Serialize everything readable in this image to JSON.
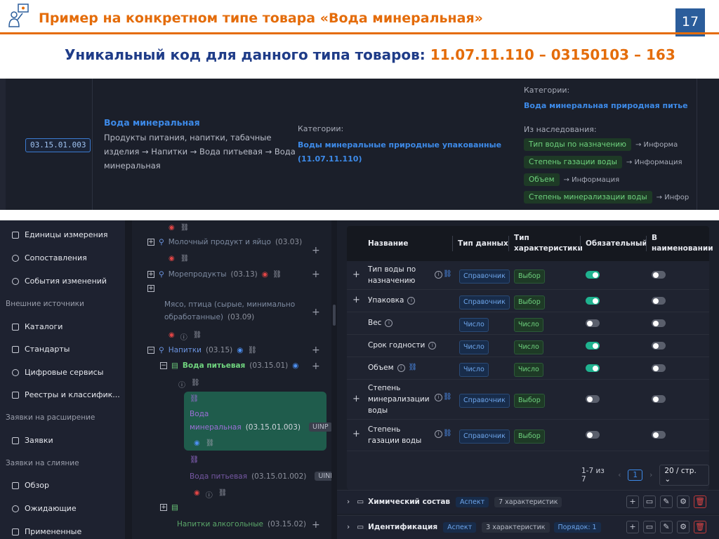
{
  "slide": {
    "title": "Пример на конкретном типе товара «Вода минеральная»",
    "number": "17",
    "subtitle_label": "Уникальный код для данного типа товаров: ",
    "subtitle_code": "11.07.11.110 – 03150103 –  163"
  },
  "top_panel": {
    "code": "03.15.01.003",
    "product_name": "Вода минеральная",
    "breadcrumb_lines": [
      "Продукты питания, напитки, табачные",
      "изделия → Напитки → Вода питьевая → Вода",
      "минеральная"
    ],
    "categories_label": "Категории:",
    "categories_value_lines": [
      "Воды минеральные природные упакованные",
      "(11.07.11.110)"
    ],
    "right_categories_label": "Категории:",
    "right_categories_value": "Вода минеральная природная питье",
    "inheritance_label": "Из наследования:",
    "inherited": [
      {
        "tag": "Тип воды по назначению",
        "info": "→ Информа"
      },
      {
        "tag": "Степень газации воды",
        "info": "→ Информация"
      },
      {
        "tag": "Объем",
        "info": "→ Информация"
      },
      {
        "tag": "Степень минерализации воды",
        "info": "→ Инфор"
      }
    ]
  },
  "sidebar": {
    "items": [
      {
        "type": "item",
        "label": "Единицы измерения"
      },
      {
        "type": "item",
        "label": "Сопоставления"
      },
      {
        "type": "item",
        "label": "События изменений"
      },
      {
        "type": "group",
        "label": "Внешние источники"
      },
      {
        "type": "item",
        "label": "Каталоги"
      },
      {
        "type": "item",
        "label": "Стандарты"
      },
      {
        "type": "item",
        "label": "Цифровые сервисы"
      },
      {
        "type": "item",
        "label": "Реестры и классифик..."
      },
      {
        "type": "group",
        "label": "Заявки на расширение"
      },
      {
        "type": "item",
        "label": "Заявки"
      },
      {
        "type": "group",
        "label": "Заявки на слияние"
      },
      {
        "type": "item",
        "label": "Обзор"
      },
      {
        "type": "item",
        "label": "Ожидающие"
      },
      {
        "type": "item",
        "label": "Примененные"
      }
    ]
  },
  "tree": {
    "dairy": {
      "name": "Молочный продукт и яйцо",
      "code": "(03.03)"
    },
    "seafood": {
      "name": "Морепродукты",
      "code": "(03.13)"
    },
    "meat_lines": [
      "Мясо, птица (сырые, минимально",
      "обработанные)"
    ],
    "meat_code": "(03.09)",
    "drinks": {
      "name": "Напитки",
      "code": "(03.15)"
    },
    "water": {
      "name": "Вода питьевая",
      "code": "(03.15.01)"
    },
    "mineral_line1": "Вода",
    "mineral_line2": "минеральная",
    "mineral_code": "(03.15.01.003)",
    "mineral_badge": "UINP",
    "drinking_water": {
      "name": "Вода питьевая",
      "code": "(03.15.01.002)",
      "badge": "UINP"
    },
    "alcohol": {
      "name": "Напитки алкогольные",
      "code": "(03.15.02)"
    }
  },
  "table": {
    "headers": {
      "name": "Название",
      "data_type": "Тип данных",
      "char_type_1": "Тип",
      "char_type_2": "характеристики",
      "required": "Обязательный",
      "in_name_1": "В",
      "in_name_2": "наименовании"
    },
    "rows": [
      {
        "name_lines": [
          "Тип воды по",
          "назначению"
        ],
        "has_link": true,
        "data_type": "Справочник",
        "char_type": "Выбор",
        "required": true,
        "in_name": false
      },
      {
        "name_lines": [
          "Упаковка"
        ],
        "has_link": false,
        "data_type": "Справочник",
        "char_type": "Выбор",
        "required": true,
        "in_name": false
      },
      {
        "name_lines": [
          "Вес"
        ],
        "has_link": false,
        "data_type": "Число",
        "char_type": "Число",
        "required": false,
        "in_name": false
      },
      {
        "name_lines": [
          "Срок годности"
        ],
        "has_link": false,
        "data_type": "Число",
        "char_type": "Число",
        "required": true,
        "in_name": false
      },
      {
        "name_lines": [
          "Объем"
        ],
        "has_link": true,
        "data_type": "Число",
        "char_type": "Число",
        "required": true,
        "in_name": false
      },
      {
        "name_lines": [
          "Степень",
          "минерализации",
          "воды"
        ],
        "has_link": true,
        "data_type": "Справочник",
        "char_type": "Выбор",
        "required": false,
        "in_name": false
      },
      {
        "name_lines": [
          "Степень",
          "газации воды"
        ],
        "has_link": true,
        "data_type": "Справочник",
        "char_type": "Выбор",
        "required": false,
        "in_name": false
      }
    ],
    "pager": {
      "range": "1-7 из 7",
      "page": "1",
      "page_size": "20 / стр."
    }
  },
  "accordion": [
    {
      "title": "Химический состав",
      "aspect": "Аспект",
      "count": "7 характеристик",
      "order": ""
    },
    {
      "title": "Идентификация",
      "aspect": "Аспект",
      "count": "3 характеристик",
      "order": "Порядок: 1"
    }
  ],
  "colors": {
    "accent_orange": "#e46c0a",
    "title_blue": "#1f3c88",
    "badge_blue": "#2b5d9b",
    "toggle_on": "#1fb28f"
  }
}
